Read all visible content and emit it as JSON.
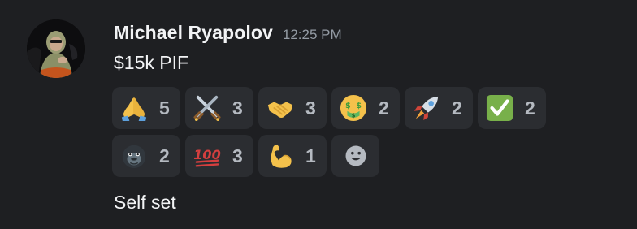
{
  "message": {
    "author": "Michael Ryapolov",
    "timestamp": "12:25 PM",
    "text": "$15k PIF",
    "followup_text": "Self set"
  },
  "reactions": [
    {
      "emoji": "folded-hands",
      "count": "5"
    },
    {
      "emoji": "crossed-swords",
      "count": "3"
    },
    {
      "emoji": "handshake",
      "count": "3"
    },
    {
      "emoji": "money-mouth-face",
      "count": "2"
    },
    {
      "emoji": "rocket",
      "count": "2"
    },
    {
      "emoji": "check-mark-button",
      "count": "2"
    },
    {
      "emoji": "gorilla",
      "count": "2"
    },
    {
      "emoji": "hundred-points",
      "count": "3"
    },
    {
      "emoji": "flexed-biceps",
      "count": "1"
    }
  ],
  "add_reaction_icon": "smiley-add-reaction",
  "colors": {
    "background": "#1e1f22",
    "reaction_pill": "#2b2d31",
    "username": "#f2f3f5",
    "timestamp": "#949ba4",
    "count": "#b5bac1"
  }
}
